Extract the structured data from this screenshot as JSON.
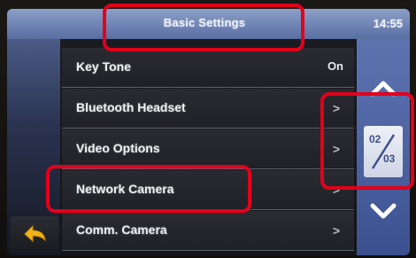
{
  "header": {
    "title": "Basic Settings",
    "clock": "14:55"
  },
  "list": {
    "items": [
      {
        "label": "Key Tone",
        "value": "On"
      },
      {
        "label": "Bluetooth Headset",
        "value": ">"
      },
      {
        "label": "Video Options",
        "value": ">"
      },
      {
        "label": "Network Camera",
        "value": ">"
      },
      {
        "label": "Comm. Camera",
        "value": ">"
      }
    ]
  },
  "scroll": {
    "page_current": "02",
    "page_total": "03"
  },
  "icons": {
    "back": "back-arrow-icon",
    "up": "chevron-up-icon",
    "down": "chevron-down-icon"
  },
  "colors": {
    "header": "#7b8fbf",
    "rail": "#5068a5",
    "annotation": "#e3001b"
  }
}
